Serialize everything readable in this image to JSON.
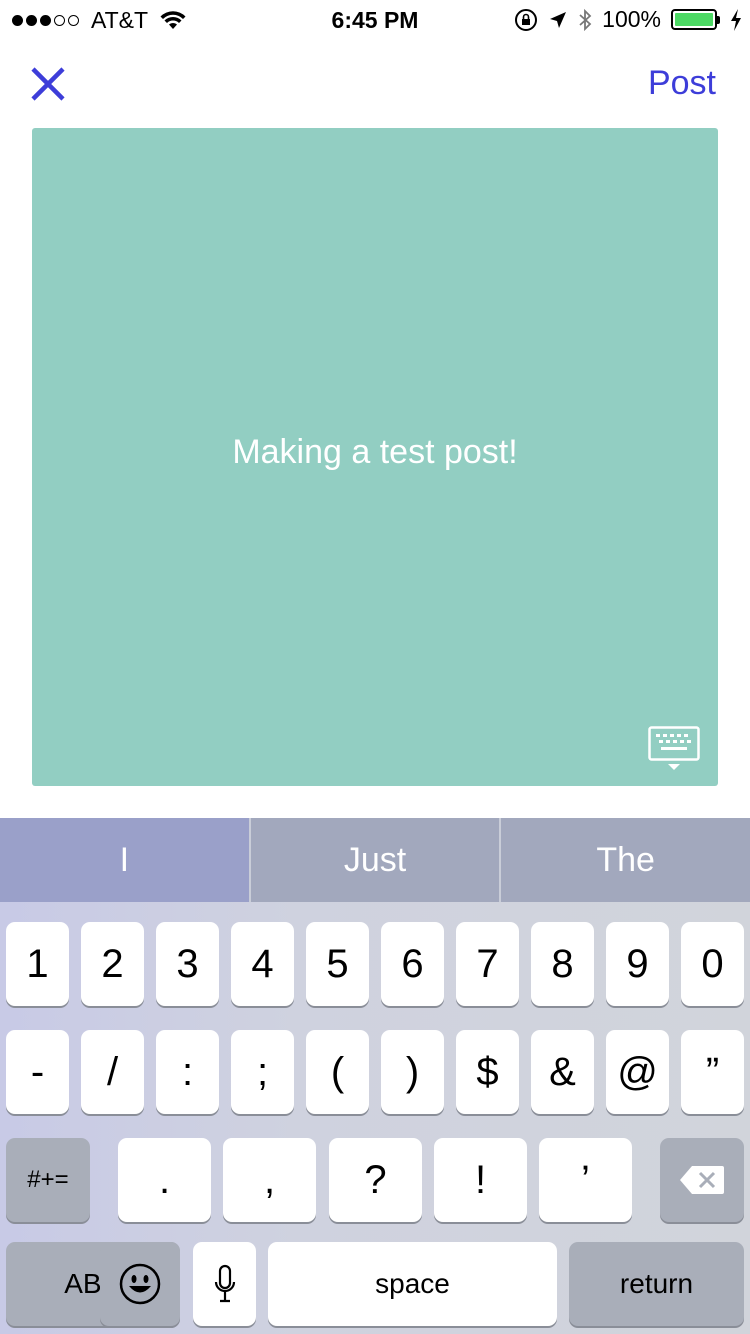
{
  "status_bar": {
    "carrier": "AT&T",
    "time": "6:45 PM",
    "battery": "100%",
    "battery_level": 1.0,
    "signal_bars_filled": 3,
    "signal_bars_total": 5
  },
  "nav": {
    "post_label": "Post",
    "close_icon": "close-icon",
    "accent_color": "#3d3dd9"
  },
  "post": {
    "text": "Making a test post!",
    "background_color": "#92cec2"
  },
  "suggestions": [
    "I",
    "Just",
    "The"
  ],
  "keyboard": {
    "row1": [
      "1",
      "2",
      "3",
      "4",
      "5",
      "6",
      "7",
      "8",
      "9",
      "0"
    ],
    "row2": [
      "-",
      "/",
      ":",
      ";",
      "(",
      ")",
      "$",
      "&",
      "@",
      "”"
    ],
    "row3_mode": "#+=",
    "row3": [
      ".",
      ",",
      "?",
      "!",
      "’"
    ],
    "abc": "ABC",
    "space": "space",
    "return": "return",
    "delete_icon": "backspace-icon",
    "emoji_icon": "emoji-icon",
    "mic_icon": "microphone-icon"
  }
}
